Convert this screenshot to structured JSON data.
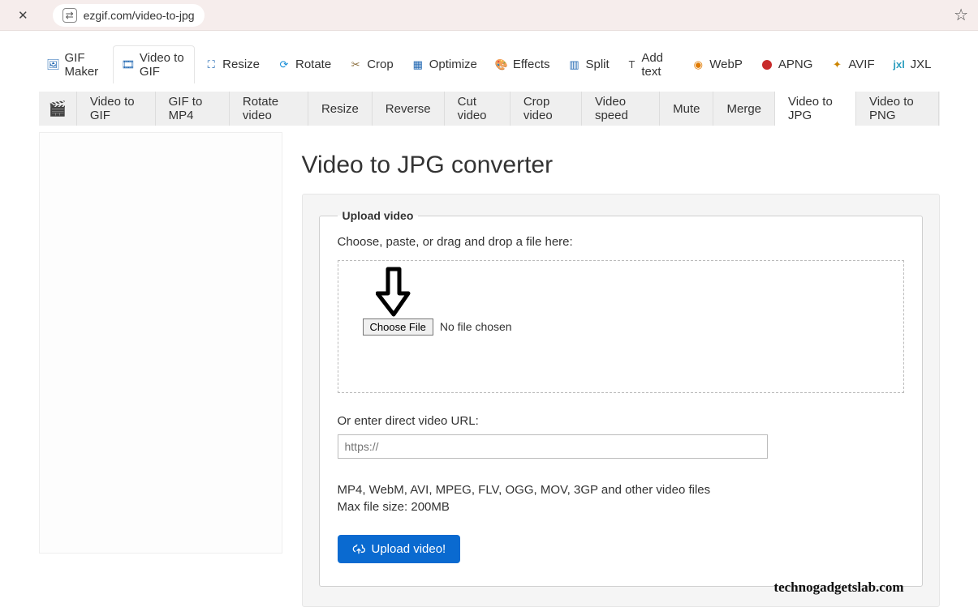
{
  "browser": {
    "url": "ezgif.com/video-to-jpg"
  },
  "topnav": {
    "items": [
      {
        "label": "GIF Maker"
      },
      {
        "label": "Video to GIF"
      },
      {
        "label": "Resize"
      },
      {
        "label": "Rotate"
      },
      {
        "label": "Crop"
      },
      {
        "label": "Optimize"
      },
      {
        "label": "Effects"
      },
      {
        "label": "Split"
      },
      {
        "label": "Add text"
      },
      {
        "label": "WebP"
      },
      {
        "label": "APNG"
      },
      {
        "label": "AVIF"
      },
      {
        "label": "JXL"
      }
    ]
  },
  "subnav": {
    "items": [
      {
        "label": "Video to GIF"
      },
      {
        "label": "GIF to MP4"
      },
      {
        "label": "Rotate video"
      },
      {
        "label": "Resize"
      },
      {
        "label": "Reverse"
      },
      {
        "label": "Cut video"
      },
      {
        "label": "Crop video"
      },
      {
        "label": "Video speed"
      },
      {
        "label": "Mute"
      },
      {
        "label": "Merge"
      },
      {
        "label": "Video to JPG"
      },
      {
        "label": "Video to PNG"
      }
    ]
  },
  "page": {
    "title": "Video to JPG converter"
  },
  "form": {
    "legend": "Upload video",
    "instruct": "Choose, paste, or drag and drop a file here:",
    "choose_btn": "Choose File",
    "no_file": "No file chosen",
    "or_label": "Or enter direct video URL:",
    "url_placeholder": "https://",
    "hint_formats": "MP4, WebM, AVI, MPEG, FLV, OGG, MOV, 3GP and other video files",
    "hint_maxsize": "Max file size: 200MB",
    "upload_btn": "Upload video!"
  },
  "watermark": "technogadgetslab.com"
}
